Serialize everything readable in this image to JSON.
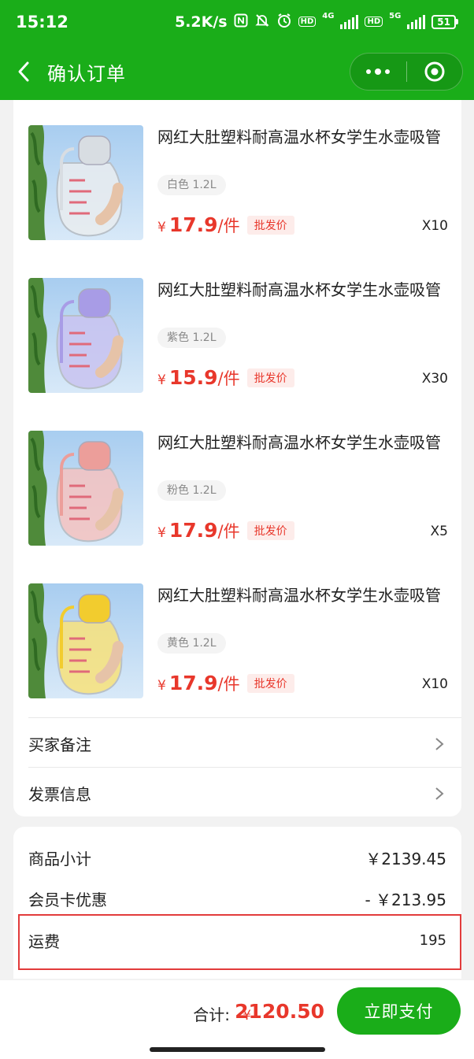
{
  "status_bar": {
    "time": "15:12",
    "network_speed": "5.2K/s",
    "network_4g": "4G",
    "network_5g": "5G",
    "hd1": "HD",
    "hd2": "HD",
    "battery": "51",
    "icons": [
      "nfc-icon",
      "mute-icon",
      "alarm-icon",
      "signal-icon",
      "battery-icon"
    ]
  },
  "nav": {
    "title": "确认订单",
    "back_icon": "chevron-left-icon",
    "more_icon": "more-dots-icon",
    "close_icon": "target-close-icon"
  },
  "goods": [
    {
      "title": "网红大肚塑料耐高温水杯女学生水壶吸管",
      "spec": "白色 1.2L",
      "currency": "¥",
      "price": "17.9",
      "unit": "/件",
      "badge": "批发价",
      "qty": "X10",
      "bottle_color": "#e9ecef",
      "accent_color": "#d8dde2"
    },
    {
      "title": "网红大肚塑料耐高温水杯女学生水壶吸管",
      "spec": "紫色 1.2L",
      "currency": "¥",
      "price": "15.9",
      "unit": "/件",
      "badge": "批发价",
      "qty": "X30",
      "bottle_color": "#c9c3f0",
      "accent_color": "#a89ce6"
    },
    {
      "title": "网红大肚塑料耐高温水杯女学生水壶吸管",
      "spec": "粉色 1.2L",
      "currency": "¥",
      "price": "17.9",
      "unit": "/件",
      "badge": "批发价",
      "qty": "X5",
      "bottle_color": "#f4c2c0",
      "accent_color": "#ec9e9a"
    },
    {
      "title": "网红大肚塑料耐高温水杯女学生水壶吸管",
      "spec": "黄色 1.2L",
      "currency": "¥",
      "price": "17.9",
      "unit": "/件",
      "badge": "批发价",
      "qty": "X10",
      "bottle_color": "#f8e27a",
      "accent_color": "#f2cc2e"
    }
  ],
  "options": {
    "remark_label": "买家备注",
    "invoice_label": "发票信息"
  },
  "summary": {
    "subtotal_label": "商品小计",
    "subtotal_value": "￥2139.45",
    "discount_label": "会员卡优惠",
    "discount_value": "- ￥213.95",
    "shipping_label": "运费",
    "shipping_value": "195"
  },
  "footer": {
    "total_label": "合计:",
    "total_currency": "¥",
    "total_value": "2120.50",
    "pay_label": "立即支付"
  },
  "colors": {
    "brand_green": "#1aad19",
    "price_red": "#e8372b",
    "highlight_red": "#e23b3b"
  }
}
